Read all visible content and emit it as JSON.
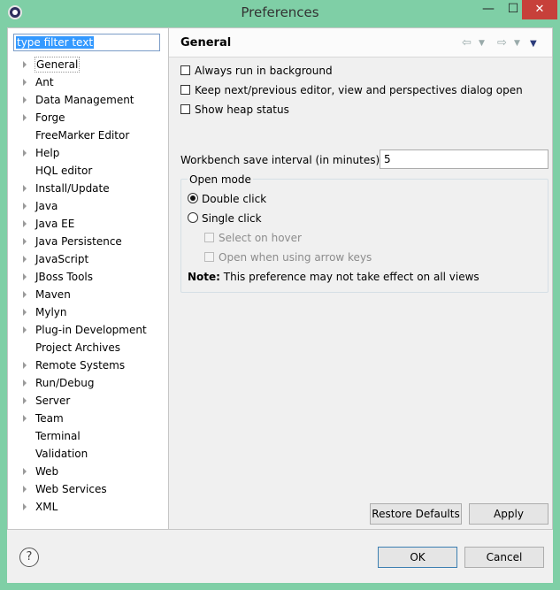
{
  "window": {
    "title": "Preferences",
    "minimize_glyph": "—",
    "maximize_glyph": "☐",
    "close_glyph": "✕"
  },
  "filter": {
    "value": "type filter text"
  },
  "tree": [
    {
      "label": "General",
      "expandable": true,
      "selected": true
    },
    {
      "label": "Ant",
      "expandable": true
    },
    {
      "label": "Data Management",
      "expandable": true
    },
    {
      "label": "Forge",
      "expandable": true
    },
    {
      "label": "FreeMarker Editor",
      "expandable": false
    },
    {
      "label": "Help",
      "expandable": true
    },
    {
      "label": "HQL editor",
      "expandable": false
    },
    {
      "label": "Install/Update",
      "expandable": true
    },
    {
      "label": "Java",
      "expandable": true
    },
    {
      "label": "Java EE",
      "expandable": true
    },
    {
      "label": "Java Persistence",
      "expandable": true
    },
    {
      "label": "JavaScript",
      "expandable": true
    },
    {
      "label": "JBoss Tools",
      "expandable": true
    },
    {
      "label": "Maven",
      "expandable": true
    },
    {
      "label": "Mylyn",
      "expandable": true
    },
    {
      "label": "Plug-in Development",
      "expandable": true
    },
    {
      "label": "Project Archives",
      "expandable": false
    },
    {
      "label": "Remote Systems",
      "expandable": true
    },
    {
      "label": "Run/Debug",
      "expandable": true
    },
    {
      "label": "Server",
      "expandable": true
    },
    {
      "label": "Team",
      "expandable": true
    },
    {
      "label": "Terminal",
      "expandable": false
    },
    {
      "label": "Validation",
      "expandable": false
    },
    {
      "label": "Web",
      "expandable": true
    },
    {
      "label": "Web Services",
      "expandable": true
    },
    {
      "label": "XML",
      "expandable": true
    }
  ],
  "page": {
    "title": "General",
    "nav": {
      "back": "⇦",
      "forward": "⇨",
      "dropdown": "▼",
      "menu": "▼"
    },
    "always_run_background": {
      "label": "Always run in background",
      "checked": false
    },
    "keep_next_previous": {
      "label": "Keep next/previous editor, view and perspectives dialog open",
      "checked": false
    },
    "show_heap_status": {
      "label": "Show heap status",
      "checked": false
    },
    "save_interval": {
      "label": "Workbench save interval (in minutes):",
      "value": "5"
    },
    "open_mode": {
      "title": "Open mode",
      "double_click": {
        "label": "Double click",
        "selected": true
      },
      "single_click": {
        "label": "Single click",
        "selected": false
      },
      "select_on_hover": {
        "label": "Select on hover",
        "checked": false,
        "enabled": false
      },
      "open_arrow_keys": {
        "label": "Open when using arrow keys",
        "checked": false,
        "enabled": false
      },
      "note_bold": "Note:",
      "note_text": " This preference may not take effect on all views"
    },
    "restore_defaults": "Restore Defaults",
    "apply": "Apply"
  },
  "footer": {
    "help_glyph": "?",
    "ok": "OK",
    "cancel": "Cancel"
  }
}
